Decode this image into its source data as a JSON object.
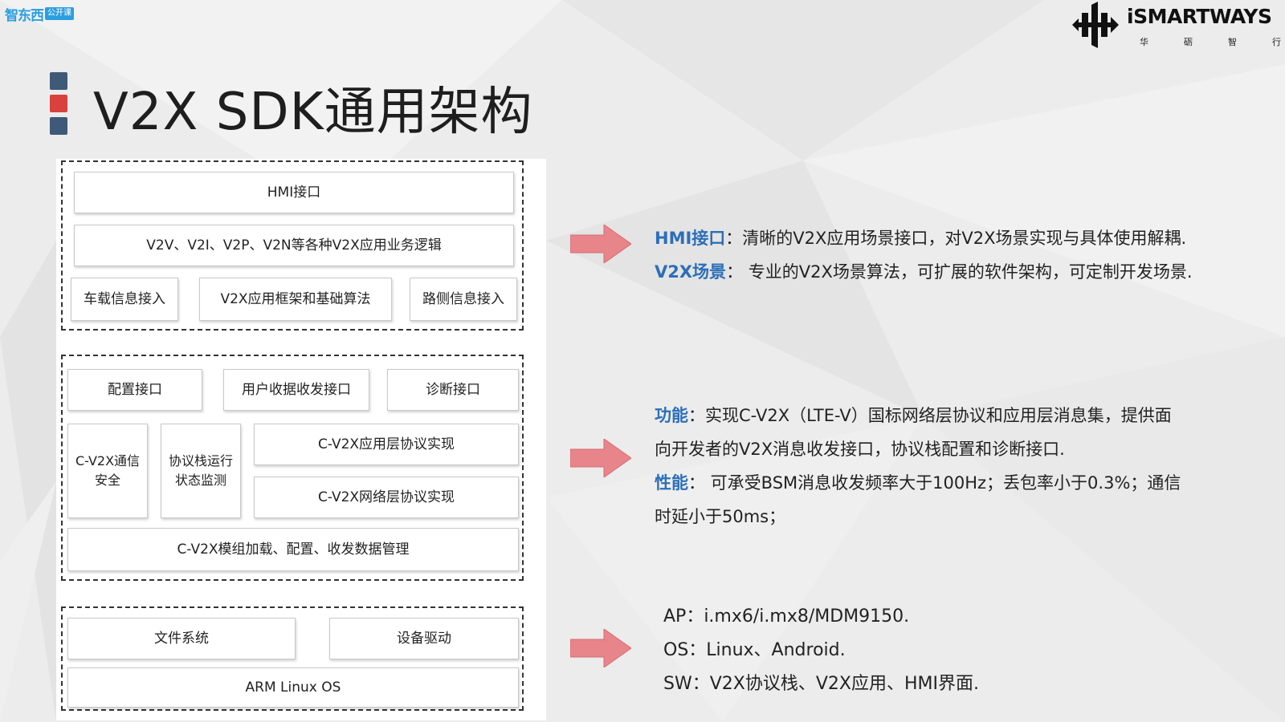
{
  "header": {
    "left_logo_text": "智东西",
    "left_logo_tag": "公开课",
    "brand_name": "iSMARTWAYS",
    "brand_sub": [
      "华",
      "砺",
      "智",
      "行"
    ]
  },
  "title": "V2X SDK通用架构",
  "diagram": {
    "app_layer": {
      "hmi": "HMI接口",
      "logic": "V2V、V2I、V2P、V2N等各种V2X应用业务逻辑",
      "vehicle_info": "车载信息接入",
      "framework": "V2X应用框架和基础算法",
      "roadside_info": "路侧信息接入"
    },
    "stack_layer": {
      "config_if": "配置接口",
      "user_data_if": "用户收据收发接口",
      "diag_if": "诊断接口",
      "security": "C-V2X通信安全",
      "monitor": "协议栈运行状态监测",
      "app_protocol": "C-V2X应用层协议实现",
      "net_protocol": "C-V2X网络层协议实现",
      "module_mgmt": "C-V2X模组加载、配置、收发数据管理"
    },
    "os_layer": {
      "filesystem": "文件系统",
      "driver": "设备驱动",
      "os": "ARM Linux OS"
    }
  },
  "descriptions": {
    "block1": {
      "line1_key": "HMI接口",
      "line1_text": "：清晰的V2X应用场景接口，对V2X场景实现与具体使用解耦.",
      "line2_key": "V2X场景",
      "line2_text": "： 专业的V2X场景算法，可扩展的软件架构，可定制开发场景."
    },
    "block2": {
      "line1_key": "功能",
      "line1_text": "：实现C-V2X（LTE-V）国标网络层协议和应用层消息集，提供面",
      "line2_text": "向开发者的V2X消息收发接口，协议栈配置和诊断接口.",
      "line3_key": "性能",
      "line3_text": "： 可承受BSM消息收发频率大于100Hz；丢包率小于0.3%；通信",
      "line4_text": "时延小于50ms；"
    },
    "block3": {
      "ap": "AP：i.mx6/i.mx8/MDM9150.",
      "os": "OS：Linux、Android.",
      "sw": "SW：V2X协议栈、V2X应用、HMI界面."
    }
  },
  "colors": {
    "accent_blue": "#2c6fb8",
    "arrow": "#e8858a",
    "title_square_blue": "#3f5a78",
    "title_square_red": "#d9413d"
  }
}
